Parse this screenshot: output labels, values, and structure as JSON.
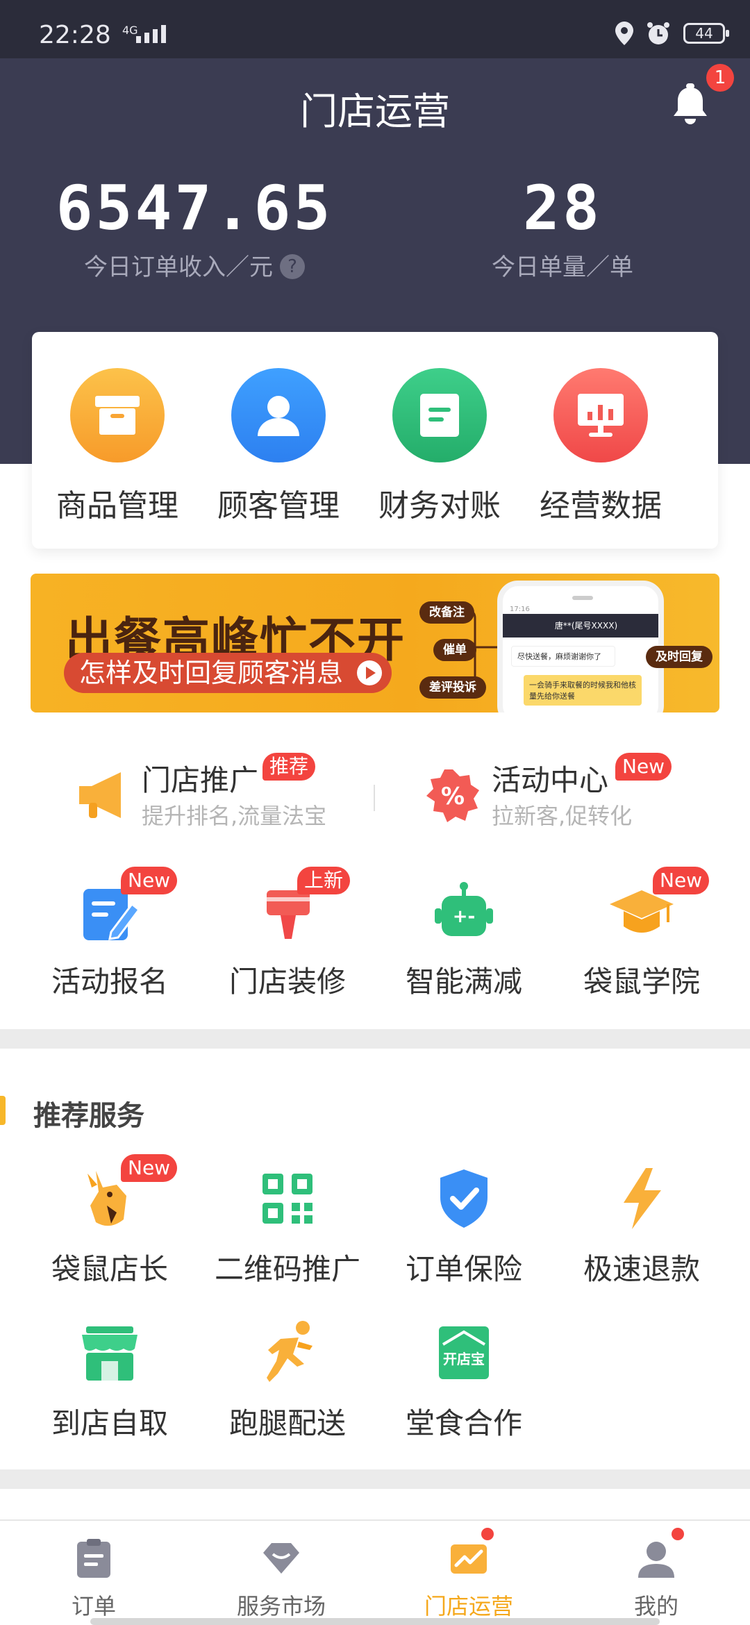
{
  "status_bar": {
    "time": "22:28",
    "network": "4G",
    "battery": "44"
  },
  "header": {
    "title": "门店运营",
    "notification_count": "1"
  },
  "stats": {
    "revenue_value": "6547.65",
    "revenue_label": "今日订单收入／元",
    "help": "?",
    "orders_value": "28",
    "orders_label": "今日单量／单"
  },
  "tools": [
    {
      "label": "商品管理",
      "icon": "box-icon",
      "color": "#f9b03a"
    },
    {
      "label": "顾客管理",
      "icon": "user-icon",
      "color": "#3a8ff5"
    },
    {
      "label": "财务对账",
      "icon": "document-icon",
      "color": "#2fbf7a"
    },
    {
      "label": "经营数据",
      "icon": "chart-board-icon",
      "color": "#f25b55"
    }
  ],
  "banner": {
    "title": "出餐高峰忙不开",
    "subtitle": "怎样及时回复顾客消息",
    "tags": [
      "改备注",
      "催单",
      "差评投诉",
      "及时回复"
    ],
    "phone_header": "唐**(尾号XXXX)",
    "phone_time": "17:16",
    "phone_msg1": "尽快送餐，麻烦谢谢你了",
    "phone_msg2": "一会骑手来取餐的时候我和他核量先给你送餐"
  },
  "promos": [
    {
      "title": "门店推广",
      "subtitle": "提升排名,流量法宝",
      "badge": "推荐",
      "icon": "megaphone-icon"
    },
    {
      "title": "活动中心",
      "subtitle": "拉新客,促转化",
      "badge": "New",
      "icon": "discount-icon"
    }
  ],
  "features": [
    {
      "label": "活动报名",
      "badge": "New",
      "icon": "signup-icon"
    },
    {
      "label": "门店装修",
      "badge": "上新",
      "icon": "paint-brush-icon"
    },
    {
      "label": "智能满减",
      "badge": "",
      "icon": "robot-icon"
    },
    {
      "label": "袋鼠学院",
      "badge": "New",
      "icon": "graduation-cap-icon"
    }
  ],
  "recommended": {
    "title": "推荐服务",
    "items": [
      {
        "label": "袋鼠店长",
        "badge": "New",
        "icon": "kangaroo-icon"
      },
      {
        "label": "二维码推广",
        "badge": "",
        "icon": "qrcode-icon"
      },
      {
        "label": "订单保险",
        "badge": "",
        "icon": "shield-icon"
      },
      {
        "label": "极速退款",
        "badge": "",
        "icon": "lightning-icon"
      },
      {
        "label": "到店自取",
        "badge": "",
        "icon": "store-icon"
      },
      {
        "label": "跑腿配送",
        "badge": "",
        "icon": "runner-icon"
      },
      {
        "label": "堂食合作",
        "badge": "",
        "icon": "dine-in-icon",
        "icon_text": "开店宝"
      }
    ]
  },
  "tabs": [
    {
      "label": "订单",
      "icon": "clipboard-icon",
      "active": false,
      "dot": false
    },
    {
      "label": "服务市场",
      "icon": "market-icon",
      "active": false,
      "dot": false
    },
    {
      "label": "门店运营",
      "icon": "store-ops-icon",
      "active": true,
      "dot": true
    },
    {
      "label": "我的",
      "icon": "profile-icon",
      "active": false,
      "dot": true
    }
  ]
}
